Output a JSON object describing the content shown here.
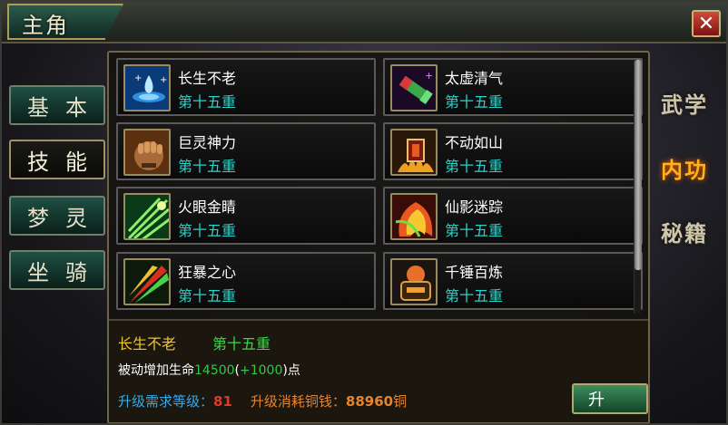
{
  "window": {
    "title": "主角",
    "close_glyph": "✕"
  },
  "left_tabs": [
    {
      "label": "基本",
      "active": false
    },
    {
      "label": "技能",
      "active": true
    },
    {
      "label": "梦灵",
      "active": false
    },
    {
      "label": "坐骑",
      "active": false
    }
  ],
  "right_tabs": [
    {
      "label": "武学",
      "active": false
    },
    {
      "label": "内功",
      "active": true
    },
    {
      "label": "秘籍",
      "active": false
    }
  ],
  "skills": [
    {
      "name": "长生不老",
      "level": "第十五重",
      "icon": "water-drop-icon"
    },
    {
      "name": "太虚清气",
      "level": "第十五重",
      "icon": "scroll-icon"
    },
    {
      "name": "巨灵神力",
      "level": "第十五重",
      "icon": "fist-icon"
    },
    {
      "name": "不动如山",
      "level": "第十五重",
      "icon": "shield-fire-icon"
    },
    {
      "name": "火眼金睛",
      "level": "第十五重",
      "icon": "green-rays-icon"
    },
    {
      "name": "仙影迷踪",
      "level": "第十五重",
      "icon": "flame-swirl-icon"
    },
    {
      "name": "狂暴之心",
      "level": "第十五重",
      "icon": "red-green-blade-icon"
    },
    {
      "name": "千锤百炼",
      "level": "第十五重",
      "icon": "forge-anvil-icon"
    }
  ],
  "detail": {
    "skill_name": "长生不老",
    "skill_level": "第十五重",
    "desc_prefix": "被动增加生命",
    "desc_value": "14500",
    "desc_open": "(",
    "desc_bonus": "+1000",
    "desc_close": ")",
    "desc_suffix": "点",
    "req_level_label": "升级需求等级：",
    "req_level_value": "81",
    "cost_label": "升级消耗铜钱：",
    "cost_value": "88960",
    "cost_unit": "铜"
  },
  "buttons": {
    "upgrade": "升"
  },
  "colors": {
    "level_cyan": "#27d4cc",
    "detail_name_yellow": "#f1c42c",
    "detail_level_green": "#3ad84a",
    "value_green": "#2fc94a",
    "req_blue": "#3aa8e8",
    "req_red": "#e03a2a",
    "cost_orange": "#e8842a",
    "active_tab_orange": "#ffb21e"
  }
}
